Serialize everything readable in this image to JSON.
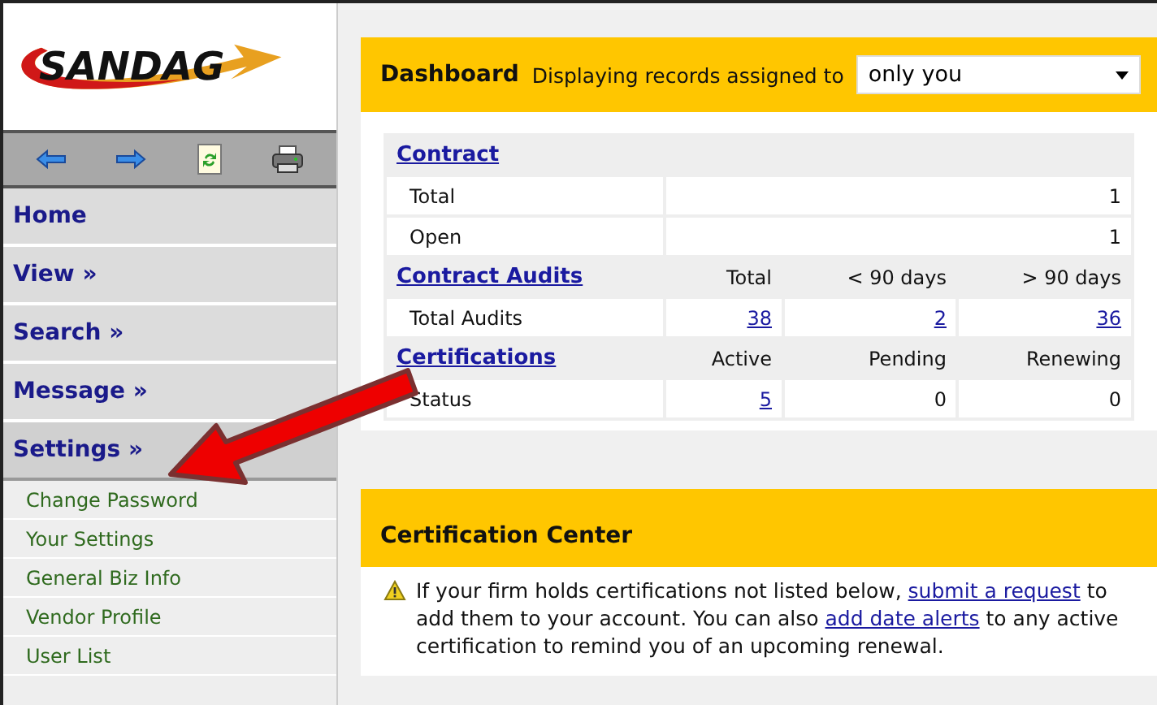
{
  "logo": {
    "text": "SANDAG"
  },
  "nav": [
    {
      "label": "Home",
      "expanded": false
    },
    {
      "label": "View »",
      "expanded": false
    },
    {
      "label": "Search »",
      "expanded": false
    },
    {
      "label": "Message »",
      "expanded": false
    },
    {
      "label": "Settings »",
      "expanded": true,
      "children": [
        "Change Password",
        "Your Settings",
        "General Biz Info",
        "Vendor Profile",
        "User List"
      ]
    }
  ],
  "dashboard": {
    "title": "Dashboard",
    "filter_label": "Displaying records assigned to",
    "filter_value": "only you",
    "sections": [
      {
        "heading": "Contract",
        "rows": [
          {
            "label": "Total",
            "cells": [
              {
                "text": "1",
                "link": false
              }
            ]
          },
          {
            "label": "Open",
            "cells": [
              {
                "text": "1",
                "link": false
              }
            ]
          }
        ]
      },
      {
        "heading": "Contract Audits",
        "columns": [
          "Total",
          "< 90 days",
          "> 90 days"
        ],
        "rows": [
          {
            "label": "Total Audits",
            "cells": [
              {
                "text": "38",
                "link": true
              },
              {
                "text": "2",
                "link": true
              },
              {
                "text": "36",
                "link": true
              }
            ]
          }
        ]
      },
      {
        "heading": "Certifications",
        "columns": [
          "Active",
          "Pending",
          "Renewing"
        ],
        "rows": [
          {
            "label": "Status",
            "cells": [
              {
                "text": "5",
                "link": true
              },
              {
                "text": "0",
                "link": false
              },
              {
                "text": "0",
                "link": false
              }
            ]
          }
        ]
      }
    ]
  },
  "certification_center": {
    "title": "Certification Center",
    "message": [
      {
        "text": "If your firm holds certifications not listed below,",
        "link": false
      },
      {
        "text": "submit a request",
        "link": true
      },
      {
        "text": "to add them to your account. You can also",
        "link": false
      },
      {
        "text": "add date alerts",
        "link": true
      },
      {
        "text": "to any active certification to remind you of an upcoming renewal.",
        "link": false
      }
    ]
  }
}
